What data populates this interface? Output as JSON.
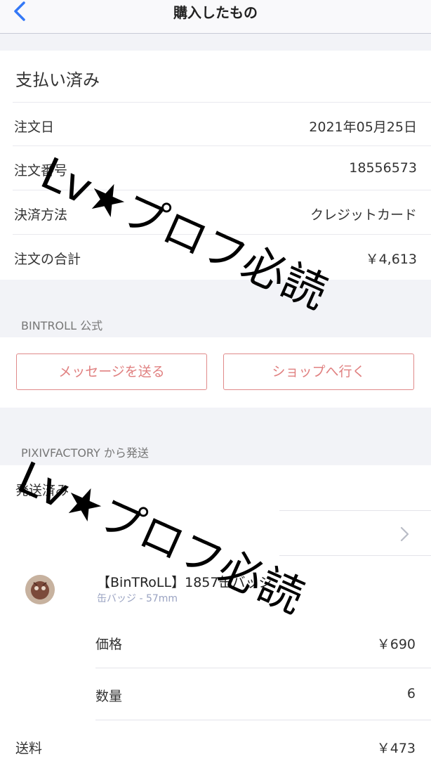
{
  "header": {
    "title": "購入したもの",
    "back_icon": "chevron-left-icon"
  },
  "order": {
    "status": "支払い済み",
    "rows": [
      {
        "label": "注文日",
        "value": "2021年05月25日"
      },
      {
        "label": "注文番号",
        "value": "18556573"
      },
      {
        "label": "決済方法",
        "value": "クレジットカード"
      },
      {
        "label": "注文の合計",
        "value": "￥4,613"
      }
    ]
  },
  "shop": {
    "name": "BINTROLL 公式",
    "message_button": "メッセージを送る",
    "shop_button": "ショップへ行く"
  },
  "shipment": {
    "from_label": "PIXIVFACTORY から発送",
    "status": "発送済み",
    "chevron_icon": "chevron-right-icon",
    "item": {
      "name": "【BinTRoLL】1857缶バッジ",
      "variant": "缶バッジ - 57mm",
      "price_label": "価格",
      "price_value": "￥690",
      "quantity_label": "数量",
      "quantity_value": "6"
    },
    "shipping_label": "送料",
    "shipping_value": "￥473"
  },
  "watermark": {
    "text": "Lv★プロフ必読"
  },
  "colors": {
    "accent": "#e08a8a",
    "background": "#f2f3f7",
    "variant_text": "#9aa3c2"
  }
}
